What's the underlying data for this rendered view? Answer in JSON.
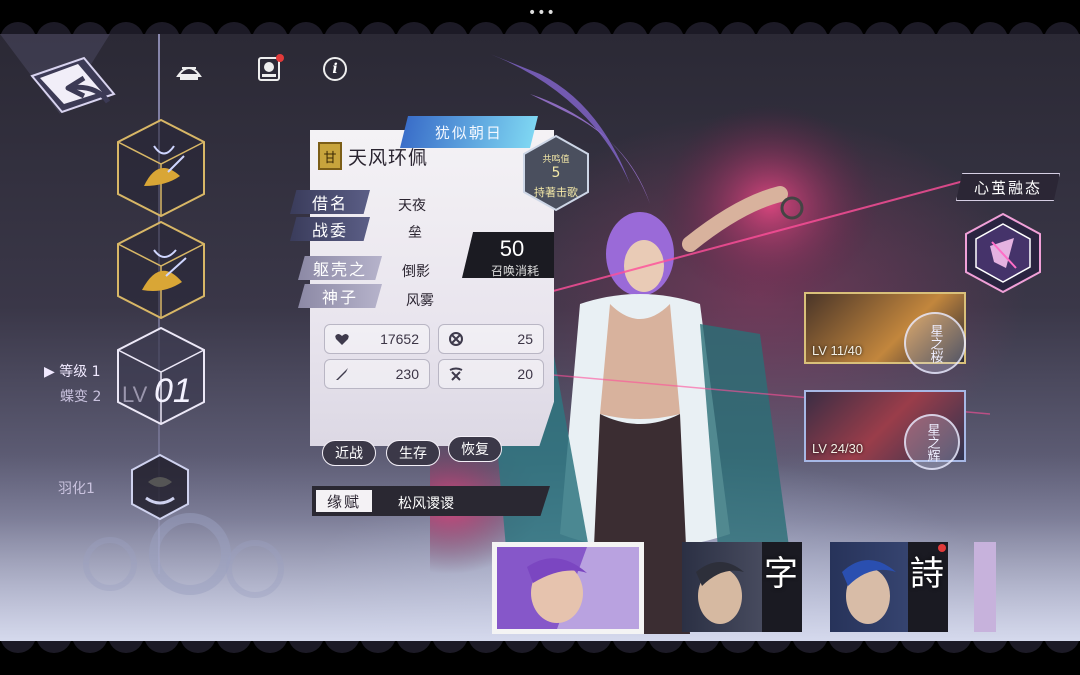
{
  "top": {
    "dots": "•••"
  },
  "header_icons": [
    "castle-icon",
    "badge-icon",
    "info-icon"
  ],
  "levels": {
    "grade": "等级 1",
    "butterfly": "蝶变 2",
    "cube_text": "LV01",
    "feather": "羽化1"
  },
  "card": {
    "emblem_char": "甘",
    "name": "天风环佩",
    "ribbon": "犹似朝日",
    "resonance": {
      "label": "共鸣值",
      "value": "5",
      "status": "持著击歌"
    },
    "alias_label": "借名",
    "alias_value": "天夜",
    "warfare_label": "战委",
    "warfare_value": "垒",
    "shell_label": "躯壳之",
    "shell_value": "倒影",
    "god_label": "神子",
    "god_value": "风雾",
    "cost": {
      "value": "50",
      "label": "召唤消耗"
    },
    "stats": [
      {
        "icon": "heart-icon",
        "value": "17652"
      },
      {
        "icon": "shield-cross-icon",
        "value": "25"
      },
      {
        "icon": "sword-icon",
        "value": "230"
      },
      {
        "icon": "crossed-swords-icon",
        "value": "20"
      }
    ],
    "tags": [
      "近战",
      "生存",
      "恢复"
    ],
    "talent_label": "缘赋",
    "talent_value": "松风谡谡"
  },
  "fusion": {
    "title": "心茧融态"
  },
  "equips": [
    {
      "lv": "LV 11/40",
      "seal": "星之桜"
    },
    {
      "lv": "LV 24/30",
      "seal": "星之辉"
    }
  ],
  "portraits": [
    {
      "glyph": ""
    },
    {
      "glyph": "字"
    },
    {
      "glyph": "詩"
    }
  ],
  "colors": {
    "accent_blue": "#3a6ec9",
    "gold": "#c8a43c",
    "card_bg": "#f4f2f5",
    "pink_glow": "#e04b86"
  }
}
